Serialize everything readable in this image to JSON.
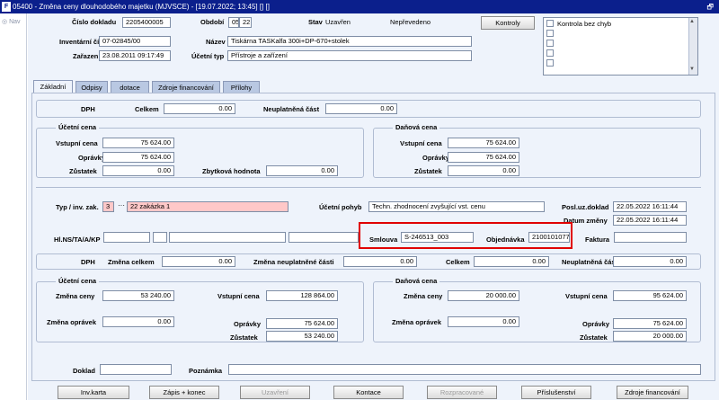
{
  "titlebar": {
    "text": "05400 - Změna ceny dlouhodobého majetku (MJVSCE) - [19.07.2022; 13:45] [] []",
    "restore": "🗗"
  },
  "nav": "Nav",
  "header": {
    "cislo_label": "Číslo dokladu",
    "cislo_value": "2205400005",
    "obdobi_label": "Období",
    "obdobi_m": "05",
    "obdobi_y": "22",
    "stav_label": "Stav",
    "stav_value": "Uzavřen",
    "stav_prevod": "Nepřevedeno",
    "kontroly": "Kontroly",
    "kontrola_text": "Kontrola bez chyb",
    "inv_label": "Inventární číslo",
    "inv_value": "07-02845/00",
    "nazev_label": "Název",
    "nazev_value": "Tiskárna TASKalfa 300i+DP-670+stolek",
    "zarazen_label": "Zařazen",
    "zarazen_value": "23.08.2011 09:17:49",
    "ucetni_typ_label": "Účetní typ",
    "ucetni_typ_value": "Přístroje a zařízení"
  },
  "tabs": [
    "Základní",
    "Odpisy",
    "dotace",
    "Zdroje financování",
    "Přílohy"
  ],
  "dph1": {
    "label": "DPH",
    "celkem_label": "Celkem",
    "celkem": "0.00",
    "neupl_label": "Neuplatněná část",
    "neupl": "0.00"
  },
  "uc1": {
    "caption": "Účetní cena",
    "vstupni_label": "Vstupní cena",
    "vstupni": "75 624.00",
    "opravky_label": "Oprávky",
    "opravky": "75 624.00",
    "zustatek_label": "Zůstatek",
    "zustatek": "0.00",
    "zbytkova_label": "Zbytková hodnota",
    "zbytkova": "0.00"
  },
  "da1": {
    "caption": "Daňová cena",
    "vstupni_label": "Vstupní cena",
    "vstupni": "75 624.00",
    "opravky_label": "Oprávky",
    "opravky": "75 624.00",
    "zustatek_label": "Zůstatek",
    "zustatek": "0.00"
  },
  "mid": {
    "typ_label": "Typ / inv. zak.",
    "typ_value": "3",
    "zak_value": "22 zakázka 1",
    "pohyb_label": "Účetní pohyb",
    "pohyb_value": "Techn. zhodnocení zvyšující vst. cenu",
    "posl_label": "Posl.uz.doklad",
    "posl_value": "22.05.2022 16:11:44",
    "datum_label": "Datum změny",
    "datum_value": "22.05.2022 16:11:44",
    "hl_label": "Hl.NS/TA/A/KP",
    "smlouva_label": "Smlouva",
    "smlouva_value": "S-246513_003",
    "obj_label": "Objednávka",
    "obj_value": "2100101077",
    "faktura_label": "Faktura"
  },
  "dph2": {
    "label": "DPH",
    "zmena_label": "Změna celkem",
    "zmena": "0.00",
    "zmena_neupl_label": "Změna neuplatněné části",
    "zmena_neupl": "0.00",
    "celkem_label": "Celkem",
    "celkem": "0.00",
    "neupl_label": "Neuplatněná část",
    "neupl": "0.00"
  },
  "uc2": {
    "caption": "Účetní cena",
    "zmena_ceny_label": "Změna ceny",
    "zmena_ceny": "53 240.00",
    "vstupni_label": "Vstupní cena",
    "vstupni": "128 864.00",
    "zmena_opr_label": "Změna oprávek",
    "zmena_opr": "0.00",
    "opravky_label": "Oprávky",
    "opravky": "75 624.00",
    "zustatek_label": "Zůstatek",
    "zustatek": "53 240.00"
  },
  "da2": {
    "caption": "Daňová cena",
    "zmena_ceny_label": "Změna ceny",
    "zmena_ceny": "20 000.00",
    "vstupni_label": "Vstupní cena",
    "vstupni": "95 624.00",
    "zmena_opr_label": "Změna oprávek",
    "zmena_opr": "0.00",
    "opravky_label": "Oprávky",
    "opravky": "75 624.00",
    "zustatek_label": "Zůstatek",
    "zustatek": "20 000.00"
  },
  "bottom": {
    "doklad_label": "Doklad",
    "poznamka_label": "Poznámka"
  },
  "buttons": {
    "invkarta": "Inv.karta",
    "zapis": "Zápis + konec",
    "uzavreni": "Uzavření",
    "kontace": "Kontace",
    "rozprac": "Rozpracované",
    "prislus": "Příslušenství",
    "zdroje": "Zdroje financování"
  },
  "colors": {
    "titlebar": "#0b1f8c",
    "form_bg": "#eef3fb",
    "required": "#ffc8c8",
    "highlight": "#e00000"
  }
}
